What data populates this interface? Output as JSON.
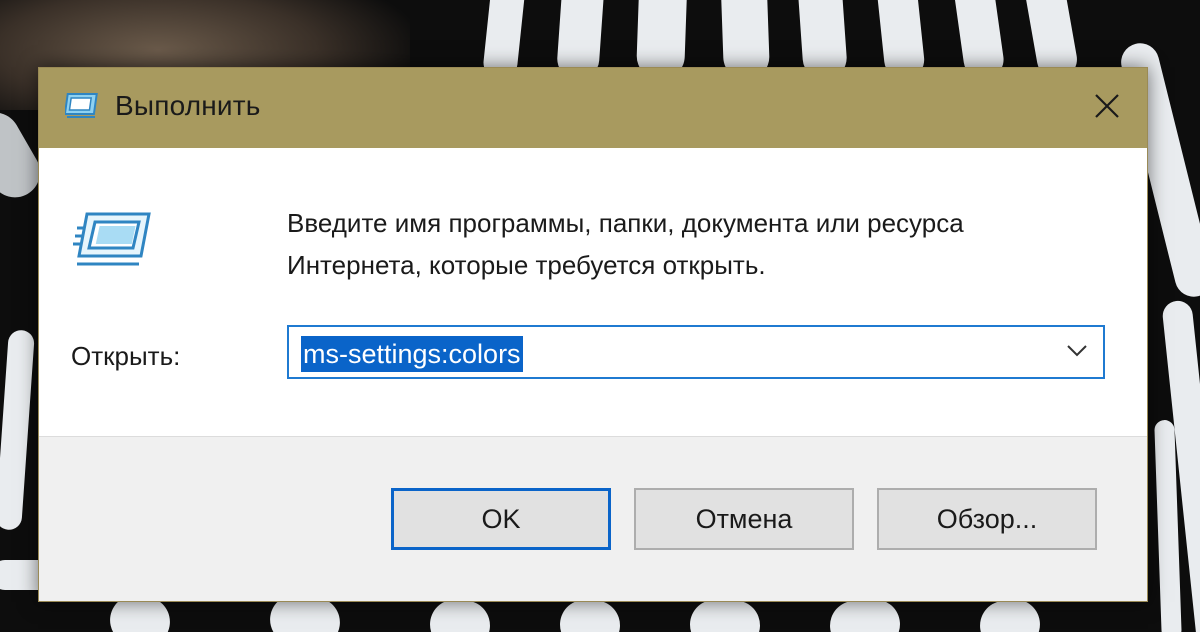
{
  "dialog": {
    "title": "Выполнить",
    "description_line1": "Введите имя программы, папки, документа или ресурса",
    "description_line2": "Интернета, которые требуется открыть.",
    "open_label": "Открыть:",
    "input_value": "ms-settings:colors",
    "buttons": {
      "ok": "OK",
      "cancel": "Отмена",
      "browse": "Обзор..."
    },
    "icons": {
      "title": "run-icon",
      "large": "run-icon",
      "close": "close-icon",
      "dropdown": "chevron-down-icon"
    }
  },
  "colors": {
    "titlebar": "#a89a5f",
    "selection": "#0a64c9",
    "focus_border": "#1f7ad1"
  }
}
